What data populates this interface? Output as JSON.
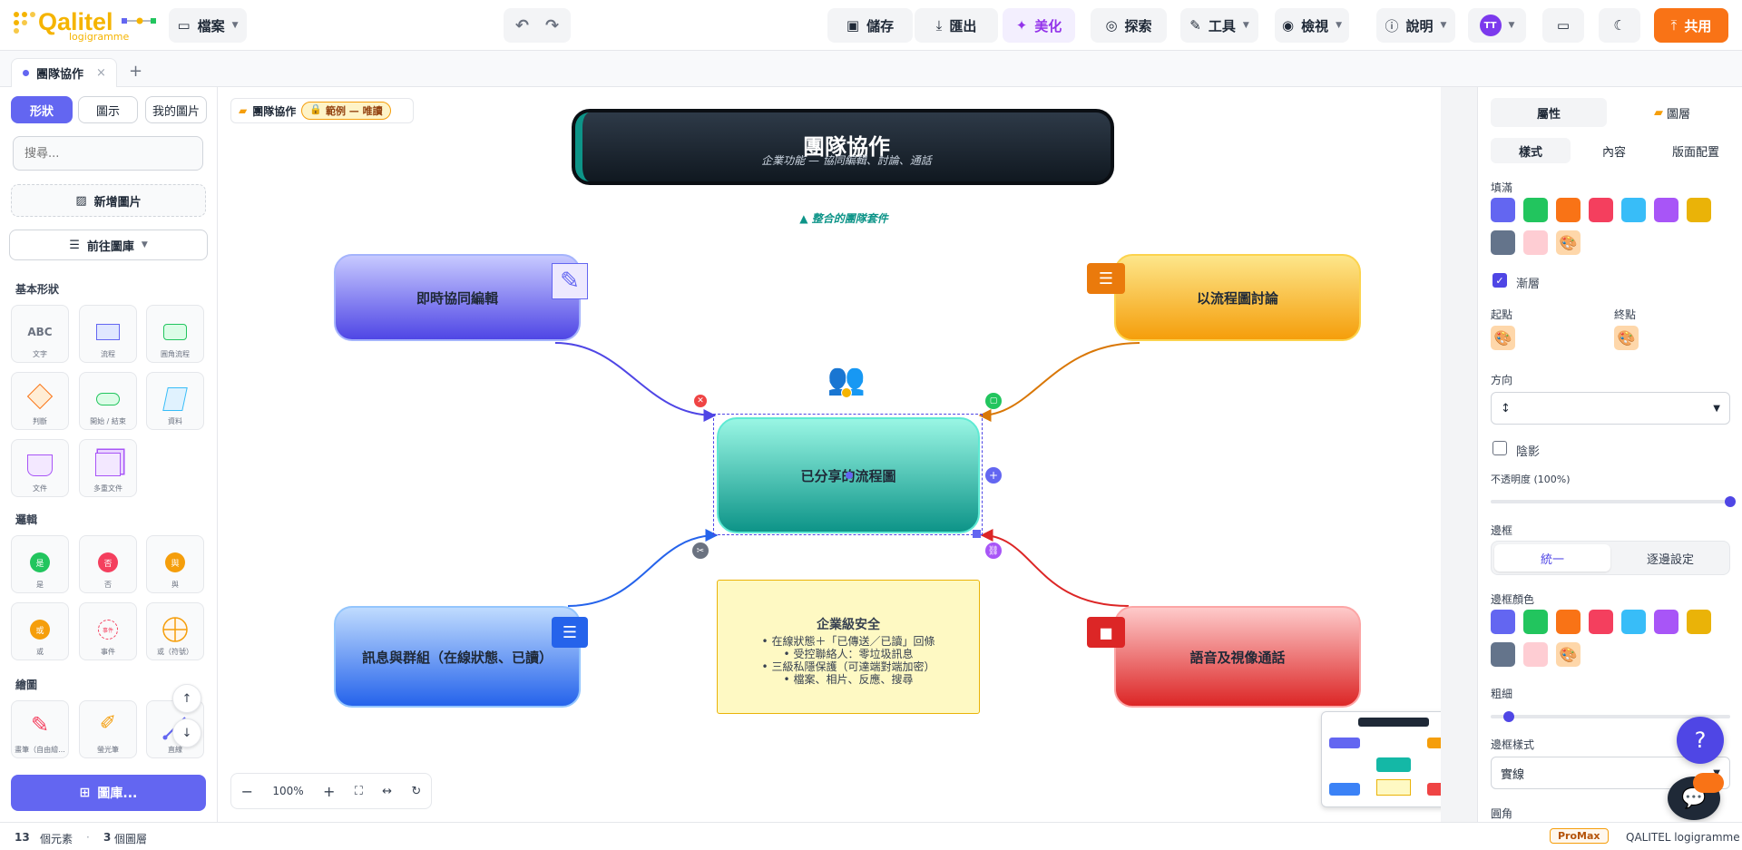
{
  "app": {
    "logo_text": "Qalitel",
    "logo_sub": "logigramme"
  },
  "toolbar": {
    "file": "檔案",
    "save": "儲存",
    "export": "匯出",
    "beautify": "美化",
    "explore": "探索",
    "tools": "工具",
    "view": "檢視",
    "help": "說明",
    "avatar": "TT",
    "share": "共用"
  },
  "tabs": [
    {
      "label": "團隊協作"
    }
  ],
  "left": {
    "tabs": [
      "形狀",
      "圖示",
      "我的圖片"
    ],
    "search_placeholder": "搜尋...",
    "add_image": "新增圖片",
    "goto_library": "前往圖庫",
    "sections": {
      "basic": "基本形狀",
      "logic": "邏輯",
      "draw": "繪圖"
    },
    "basic_shapes": [
      "文字",
      "流程",
      "圓角流程",
      "判斷",
      "開始 / 結束",
      "資料",
      "文件",
      "多重文件"
    ],
    "logic_shapes": [
      "是",
      "否",
      "與",
      "或",
      "事件",
      "或（符號）"
    ],
    "logic_glyphs": [
      "是",
      "否",
      "與",
      "或",
      "事件"
    ],
    "draw_shapes": [
      "畫筆（自由繪...",
      "螢光筆",
      "直線"
    ],
    "library_button": "圖庫...",
    "abc_glyph": "ABC"
  },
  "canvas": {
    "breadcrumb": "團隊協作",
    "badge": "範例 — 唯讀",
    "title": "團隊協作",
    "subtitle": "企業功能 — 協同編輯、討論、通話",
    "annotation": "▲ 整合的團隊套件",
    "nodes": {
      "edit": "即時協同編輯",
      "discuss": "以流程圖討論",
      "center": "已分享的流程圖",
      "chat": "訊息與群組（在線狀態、已讀）",
      "call": "語音及視像通話"
    },
    "security": {
      "title": "企業級安全",
      "lines": [
        "• 在線狀態＋「已傳送／已讀」回條",
        "• 受控聯絡人：零垃圾訊息",
        "• 三級私隱保護（可達端對端加密）",
        "• 檔案、相片、反應、搜尋"
      ]
    },
    "zoom": "100%"
  },
  "right": {
    "tabs": [
      "屬性",
      "圖層"
    ],
    "subtabs": [
      "樣式",
      "內容",
      "版面配置"
    ],
    "fill_label": "填滿",
    "gradient_label": "漸層",
    "gradient_checked": true,
    "start_label": "起點",
    "end_label": "終點",
    "direction_label": "方向",
    "direction_value": "↕",
    "shadow_label": "陰影",
    "shadow_checked": false,
    "opacity_label": "不透明度 (100%)",
    "opacity_value": 1.0,
    "border_label": "邊框",
    "border_modes": [
      "統一",
      "逐邊設定"
    ],
    "border_color_label": "邊框顏色",
    "thickness_label": "粗細",
    "border_style_label": "邊框樣式",
    "border_style_value": "實線",
    "radius_label": "圓角",
    "colors": [
      "#6366f1",
      "#22c55e",
      "#f97316",
      "#f43f5e",
      "#38bdf8",
      "#a855f7",
      "#eab308",
      "#64748b",
      "#fecdd3"
    ]
  },
  "status": {
    "elements_count": "13",
    "elements_label": "個元素",
    "layers_count": "3",
    "layers_label": "個圖層",
    "plan": "ProMax",
    "product": "QALITEL logigramme"
  }
}
